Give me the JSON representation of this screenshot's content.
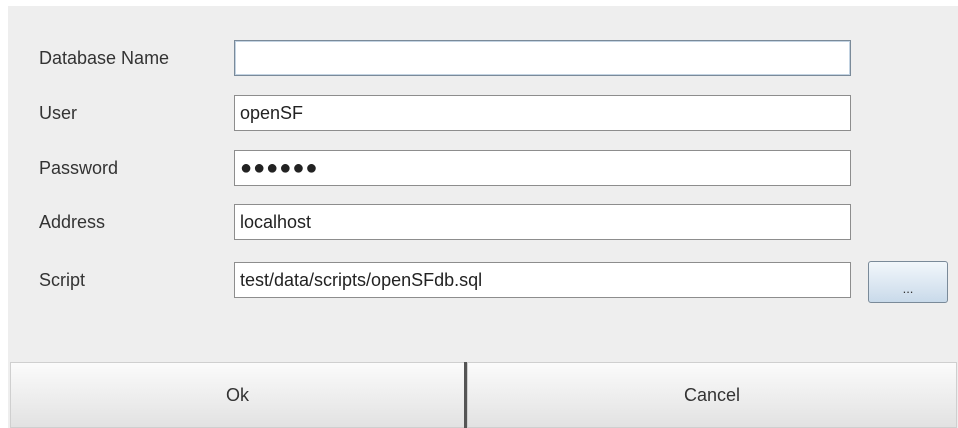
{
  "form": {
    "database_name": {
      "label": "Database Name",
      "value": ""
    },
    "user": {
      "label": "User",
      "value": "openSF"
    },
    "password": {
      "label": "Password",
      "value": "●●●●●●"
    },
    "address": {
      "label": "Address",
      "value": "localhost"
    },
    "script": {
      "label": "Script",
      "value": "test/data/scripts/openSFdb.sql"
    }
  },
  "buttons": {
    "browse_label": "...",
    "ok_label": "Ok",
    "cancel_label": "Cancel"
  },
  "colors": {
    "dialog_background": "#eeeeee",
    "field_border": "#8d8d8d",
    "browse_button_gradient_top": "#f2f7fb",
    "browse_button_gradient_bottom": "#c9daea"
  }
}
